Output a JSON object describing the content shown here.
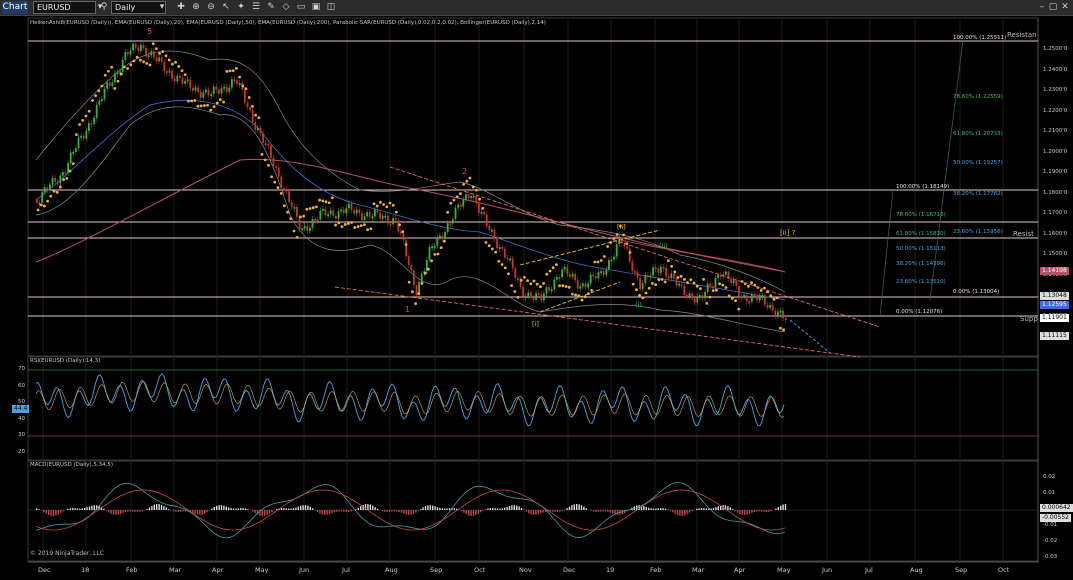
{
  "toolbar": {
    "title": "Chart",
    "instrument": "EURUSD",
    "period": "Daily",
    "icons": [
      "search-icon",
      "crosshair-icon",
      "zoom-in-icon",
      "zoom-out-icon",
      "cursor-icon",
      "magic-wand-icon",
      "properties-icon",
      "pencil-icon",
      "drawing-icon",
      "data-box-icon",
      "strategy-icon",
      "chart-trader-icon"
    ]
  },
  "indicators_label": "HeikenAshi8(EURUSD (Daily)), EMA(EURUSD (Daily),20), EMA(EURUSD (Daily),50), EMA(EURUSD (Daily),200), Parabolic SAR(EURUSD (Daily),0.02,0.2,0.02), Bollinger(EURUSD (Daily),2,14)",
  "rsi_label": "RSI(EURUSD (Daily),14,3)",
  "macd_label": "MACD(EURUSD (Daily),5,34,5)",
  "copyright": "© 2019 NinjaTrader, LLC",
  "price_axis": [
    "1.2500'0",
    "1.2400'0",
    "1.2300'0",
    "1.2200'0",
    "1.2100'0",
    "1.2000'0",
    "1.1900'0",
    "1.1800'0",
    "1.1700'0",
    "1.1600'0",
    "1.1500'0",
    "1.1400'0",
    "1.1300'0",
    "1.1200'0"
  ],
  "price_markers": {
    "p1": "1.14198",
    "p2": "1.13048",
    "p3": "1.12595",
    "p4": "1.11901",
    "p5": "1.11115"
  },
  "labels_right": {
    "resistance1": "Resistan",
    "resistance2": "Resist",
    "support": "Supp"
  },
  "rsi_axis": [
    "70",
    "60",
    "50",
    "40",
    "30",
    "20"
  ],
  "rsi_value": "44.4",
  "macd_axis": [
    "0.02",
    "0.01",
    "-0.01",
    "-0.02",
    "-0.03"
  ],
  "macd_values": {
    "v1": "0.000642",
    "v2": "-0.00552"
  },
  "x_axis": [
    "Dec",
    "18",
    "Feb",
    "Mar",
    "Apr",
    "May",
    "Jun",
    "Jul",
    "Aug",
    "Sep",
    "Oct",
    "Nov",
    "Dec",
    "19",
    "Feb",
    "Mar",
    "Apr",
    "May",
    "Jun",
    "Jul",
    "Aug",
    "Sep",
    "Oct"
  ],
  "fib_upper": [
    {
      "text": "100.00% (1.25511)",
      "color": "#e6e6e6"
    },
    {
      "text": "78.60% (1.22559)",
      "color": "#4fbf4f"
    },
    {
      "text": "61.80% (1.20733)",
      "color": "#3fb3a8"
    },
    {
      "text": "50.00% (1.19257)",
      "color": "#4aa3e0"
    },
    {
      "text": "38.20% (1.17782)",
      "color": "#4aa3e0"
    },
    {
      "text": "23.60% (1.15956)",
      "color": "#4aa3e0"
    },
    {
      "text": "0.00% (1.13004)",
      "color": "#e6e6e6"
    }
  ],
  "fib_lower": [
    {
      "text": "100.00% (1.18149)",
      "color": "#e6e6e6"
    },
    {
      "text": "78.60% (1.16716)",
      "color": "#4fbf4f"
    },
    {
      "text": "61.80% (1.15830)",
      "color": "#3fb3a8"
    },
    {
      "text": "50.00% (1.15113)",
      "color": "#4aa3e0"
    },
    {
      "text": "38.20% (1.14396)",
      "color": "#4aa3e0"
    },
    {
      "text": "23.60% (1.13510)",
      "color": "#4aa3e0"
    },
    {
      "text": "0.00% (1.12076)",
      "color": "#e6e6e6"
    }
  ],
  "waves": {
    "w5": "5",
    "w2": "2",
    "w1": "1",
    "wii": "[ii]",
    "wii_q": "[ii] ?",
    "wi": "[i]",
    "gi": "(i)",
    "gii": "(ii)"
  },
  "colors": {
    "bull": "#3fae3f",
    "bear": "#c0392b",
    "sar": "#f0b03a",
    "ema200": "#b5506a",
    "ema50": "#3c6fd1",
    "rsi": "#4aa3e0"
  }
}
